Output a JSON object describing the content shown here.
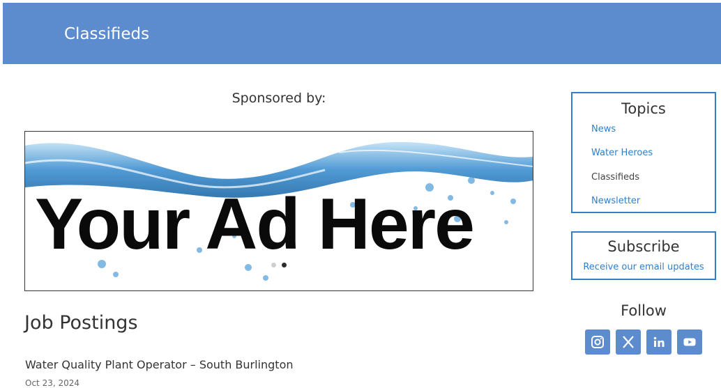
{
  "header": {
    "title": "Classifieds"
  },
  "sponsor": {
    "label": "Sponsored by:",
    "ad_text": "Your Ad Here"
  },
  "jobs": {
    "heading": "Job Postings",
    "items": [
      {
        "title": "Water Quality Plant Operator – South Burlington",
        "date": "Oct 23, 2024"
      }
    ]
  },
  "topics": {
    "title": "Topics",
    "items": [
      {
        "label": "News"
      },
      {
        "label": "Water Heroes"
      },
      {
        "label": "Classifieds"
      },
      {
        "label": "Newsletter"
      }
    ]
  },
  "subscribe": {
    "title": "Subscribe",
    "link": "Receive our email updates"
  },
  "follow": {
    "title": "Follow",
    "icons": [
      "instagram-icon",
      "x-icon",
      "linkedin-icon",
      "youtube-icon"
    ]
  },
  "colors": {
    "header_bg": "#5c8bce",
    "link": "#2e7fcc",
    "box_border": "#2e7fcc"
  }
}
